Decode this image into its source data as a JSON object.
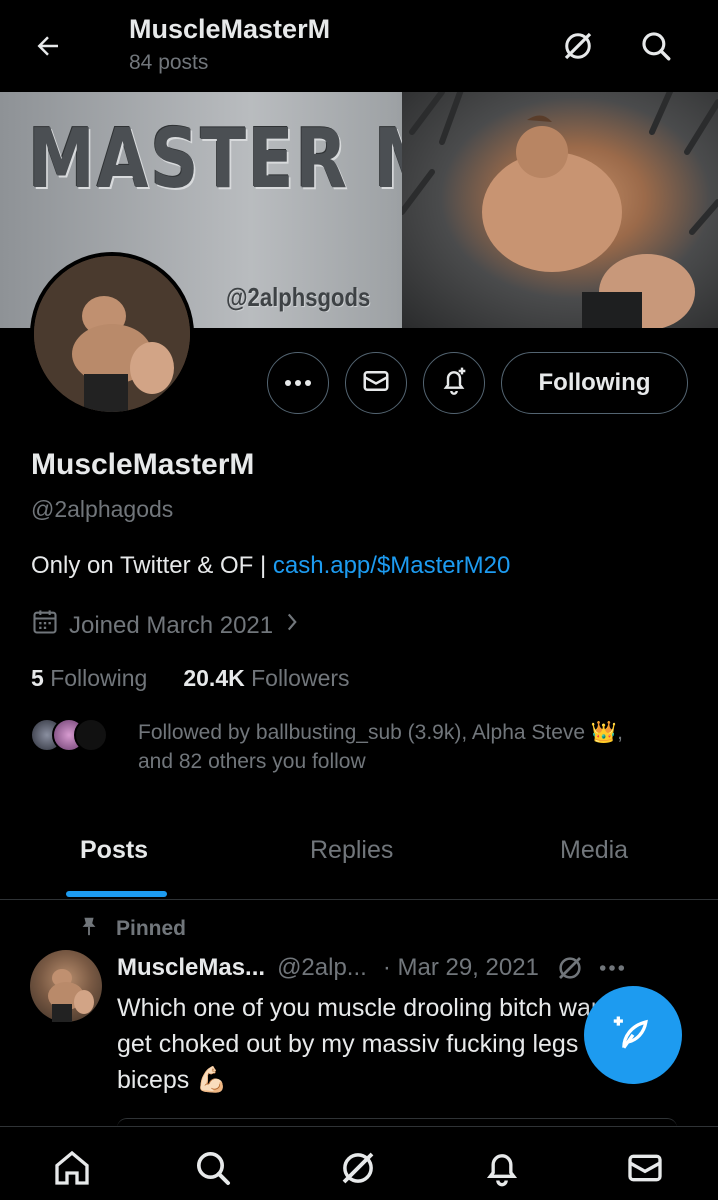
{
  "header": {
    "name": "MuscleMasterM",
    "posts_count": "84 posts"
  },
  "banner": {
    "title": "MASTER M",
    "handle": "@2alphsgods"
  },
  "profile": {
    "following_button": "Following",
    "name": "MuscleMasterM",
    "handle": "@2alphagods",
    "bio_text": "Only on Twitter & OF | ",
    "bio_link": "cash.app/$MasterM20",
    "joined": "Joined March 2021",
    "following_count": "5",
    "following_label": "Following",
    "followers_count": "20.4K",
    "followers_label": "Followers",
    "followed_by_line1": "Followed by ballbusting_sub (3.9k), Alpha Steve 👑,",
    "followed_by_line2": "and 82 others you follow"
  },
  "tabs": [
    {
      "label": "Posts"
    },
    {
      "label": "Replies"
    },
    {
      "label": "Media"
    }
  ],
  "post": {
    "pinned_label": "Pinned",
    "author": "MuscleMas...",
    "handle": "@2alp...",
    "date": "· Mar 29, 2021",
    "text": "Which one of you muscle drooling bitch wants to get choked out by my massiv fucking legs and biceps 💪🏻"
  },
  "colors": {
    "accent": "#1d9bf0",
    "background": "#000000",
    "muted": "#71767b",
    "text": "#e7e9ea"
  },
  "icons": [
    "back-arrow-icon",
    "grok-icon",
    "search-icon",
    "more-icon",
    "mail-icon",
    "bell-plus-icon",
    "calendar-icon",
    "chevron-right-icon",
    "pin-icon",
    "compose-icon",
    "home-icon",
    "bell-icon"
  ]
}
